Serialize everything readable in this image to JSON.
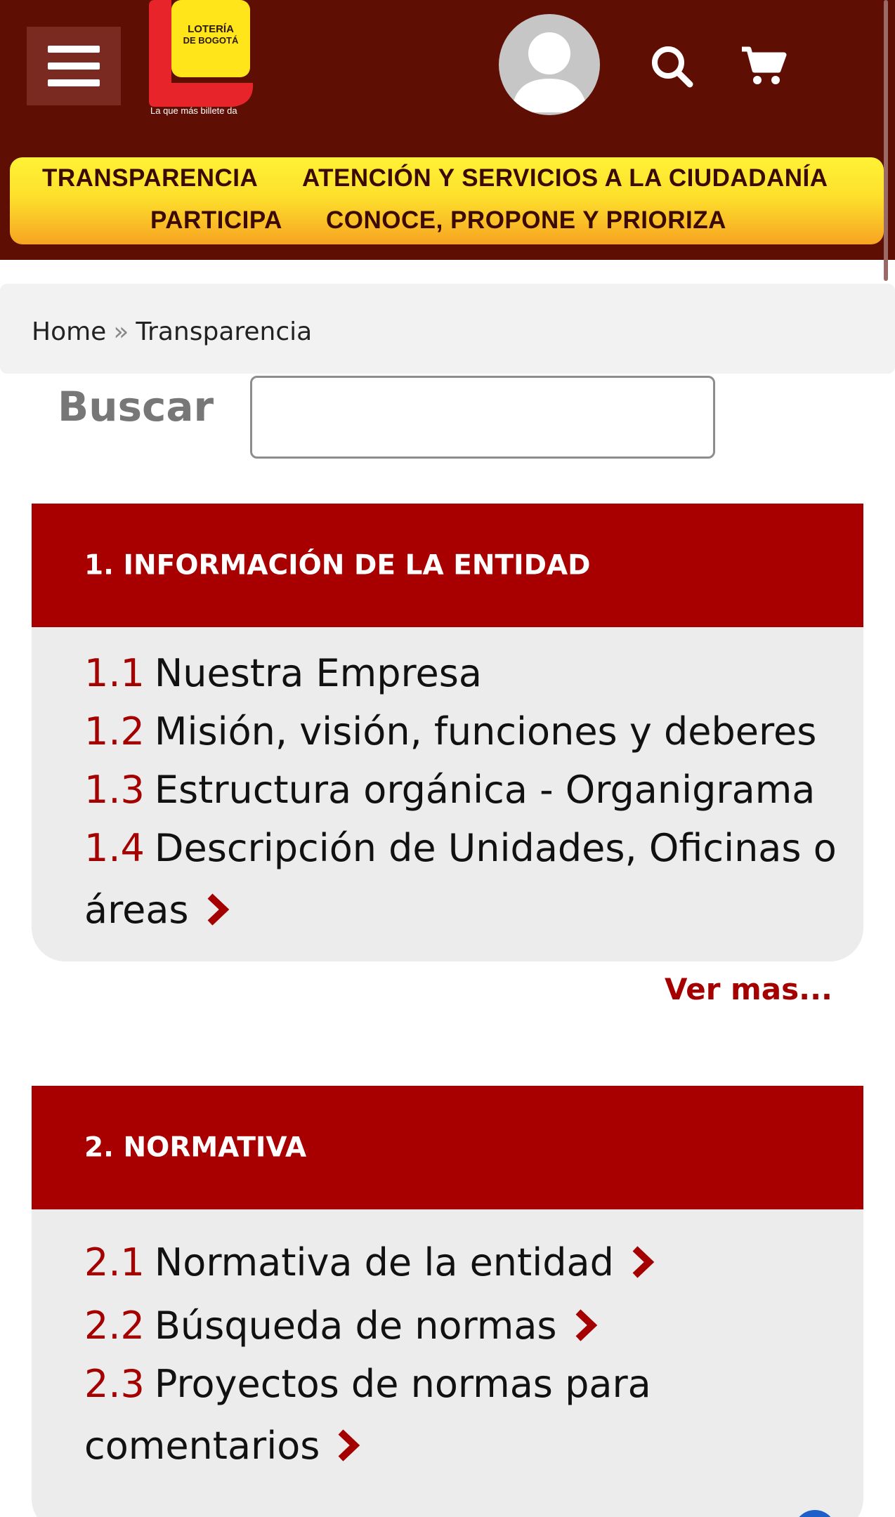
{
  "header": {
    "logo_text_line1": "LOTERÍA",
    "logo_text_line2": "DE BOGOTÁ",
    "logo_tagline": "La que más billete da",
    "brand_colors": {
      "header_bg": "#5f0e04",
      "accent_red": "#a80000",
      "nav_yellow": "#fde02c"
    }
  },
  "nav": {
    "items": [
      {
        "label": "TRANSPARENCIA"
      },
      {
        "label": "ATENCIÓN Y SERVICIOS A LA CIUDADANÍA"
      },
      {
        "label": "PARTICIPA"
      },
      {
        "label": "CONOCE, PROPONE Y PRIORIZA"
      }
    ]
  },
  "breadcrumb": {
    "home": "Home",
    "separator": "»",
    "current": "Transparencia"
  },
  "search": {
    "label": "Buscar",
    "value": "",
    "placeholder": ""
  },
  "sections": [
    {
      "title": "1. INFORMACIÓN DE LA ENTIDAD",
      "items": [
        {
          "num": "1.1",
          "label": "Nuestra Empresa"
        },
        {
          "num": "1.2",
          "label": "Misión, visión, funciones y deberes"
        },
        {
          "num": "1.3",
          "label": "Estructura orgánica - Organigrama"
        },
        {
          "num": "1.4",
          "label": "Descripción de Unidades, Oficinas o",
          "label_cont": "áreas"
        }
      ],
      "more_link": "Ver mas..."
    },
    {
      "title": "2. NORMATIVA",
      "items": [
        {
          "num": "2.1",
          "label": "Normativa de la entidad"
        },
        {
          "num": "2.2",
          "label": "Búsqueda de normas"
        },
        {
          "num": "2.3",
          "label": "Proyectos de normas para",
          "label_cont": "comentarios"
        }
      ]
    }
  ],
  "icons": [
    "menu-icon",
    "user-avatar-icon",
    "search-icon",
    "cart-icon",
    "chevron-right-icon"
  ]
}
